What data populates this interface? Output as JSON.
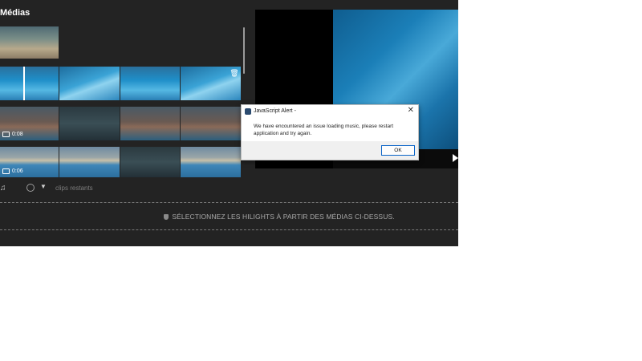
{
  "panel": {
    "title": "Médias"
  },
  "thumbnails": [
    {
      "name": "thumb-beach",
      "duration": ""
    },
    {
      "name": "thumb-pool-selected",
      "duration": ""
    },
    {
      "name": "thumb-diver",
      "duration": ""
    },
    {
      "name": "thumb-swimmer",
      "duration": ""
    },
    {
      "name": "thumb-pool-deleteable",
      "duration": ""
    }
  ],
  "clips": [
    {
      "duration": "0:08"
    },
    {
      "duration": "0:06"
    }
  ],
  "toolbar": {
    "clips_remaining_label": "clips restants"
  },
  "timeline": {
    "hint": "SÉLECTIONNEZ LES HILIGHTS À PARTIR DES MÉDIAS CI-DESSUS."
  },
  "dialog": {
    "title": "JavaScript Alert -",
    "message": "We have encountered an issue loading music, please restart application and try again.",
    "ok_label": "OK"
  },
  "icons": {
    "music": "music-icon",
    "clock": "clock-icon",
    "chevron": "chevron-down-icon",
    "trash": "trash-icon",
    "camera": "video-camera-icon",
    "play": "play-icon",
    "close": "close-icon",
    "shield": "shield-icon"
  }
}
